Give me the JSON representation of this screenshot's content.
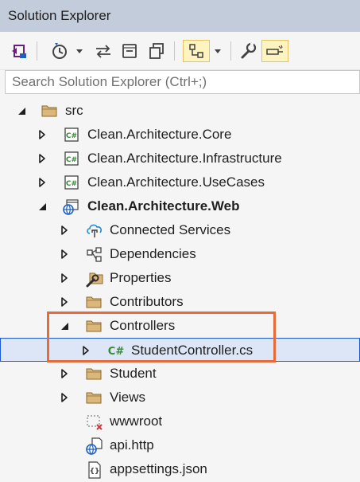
{
  "window": {
    "title": "Solution Explorer"
  },
  "toolbar": {
    "buttons": [
      {
        "name": "switch-views-icon"
      },
      {
        "name": "pending-changes-filter-icon"
      },
      {
        "name": "dropdown-arrow-icon"
      },
      {
        "name": "sync-with-active-document-icon"
      },
      {
        "name": "collapse-all-icon"
      },
      {
        "name": "show-all-files-icon"
      },
      {
        "name": "preview-selected-items-icon"
      },
      {
        "name": "dropdown-arrow-icon"
      },
      {
        "name": "properties-wrench-icon"
      },
      {
        "name": "toggle-preview-icon"
      }
    ]
  },
  "search": {
    "placeholder": "Search Solution Explorer (Ctrl+;)"
  },
  "tree": {
    "items": [
      {
        "label": "src",
        "icon": "folder-icon",
        "expander": "expanded"
      },
      {
        "label": "Clean.Architecture.Core",
        "icon": "csharp-project-icon",
        "expander": "collapsed"
      },
      {
        "label": "Clean.Architecture.Infrastructure",
        "icon": "csharp-project-icon",
        "expander": "collapsed"
      },
      {
        "label": "Clean.Architecture.UseCases",
        "icon": "csharp-project-icon",
        "expander": "collapsed"
      },
      {
        "label": "Clean.Architecture.Web",
        "icon": "web-project-icon",
        "expander": "expanded",
        "bold": true
      },
      {
        "label": "Connected Services",
        "icon": "connected-services-icon",
        "expander": "collapsed"
      },
      {
        "label": "Dependencies",
        "icon": "dependencies-icon",
        "expander": "collapsed"
      },
      {
        "label": "Properties",
        "icon": "properties-folder-icon",
        "expander": "collapsed"
      },
      {
        "label": "Contributors",
        "icon": "folder-icon",
        "expander": "collapsed"
      },
      {
        "label": "Controllers",
        "icon": "folder-icon",
        "expander": "expanded"
      },
      {
        "label": "StudentController.cs",
        "icon": "csharp-file-icon",
        "expander": "collapsed",
        "selected": true
      },
      {
        "label": "Student",
        "icon": "folder-icon",
        "expander": "collapsed"
      },
      {
        "label": "Views",
        "icon": "folder-icon",
        "expander": "collapsed"
      },
      {
        "label": "wwwroot",
        "icon": "wwwroot-excluded-icon",
        "expander": "none"
      },
      {
        "label": "api.http",
        "icon": "http-file-icon",
        "expander": "none"
      },
      {
        "label": "appsettings.json",
        "icon": "json-file-icon",
        "expander": "none"
      }
    ]
  },
  "colors": {
    "titlebar": "#c3ccdb",
    "selection_border": "#1c5ad4",
    "selection_fill": "#dde6f6",
    "highlight_box": "#e86a3a",
    "folder": "#dcb67a"
  }
}
